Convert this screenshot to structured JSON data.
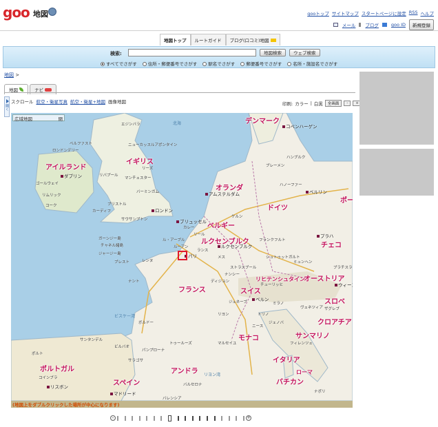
{
  "header": {
    "logo": "goo",
    "service": "地図",
    "links_top": [
      "gooトップ",
      "サイトマップ",
      "スタートページに設定",
      "RSS",
      "ヘルプ"
    ],
    "links_bottom": [
      "メール",
      "ブログ",
      "goo ID"
    ],
    "signup": "新規登録"
  },
  "tabs": [
    "地図トップ",
    "ルートガイド",
    "ブログ(口コミ)地図"
  ],
  "search": {
    "label": "検索:",
    "value": "",
    "map_button": "地図検索",
    "web_button": "ウェブ検索",
    "options": [
      "すべてでさがす",
      "住所・郵便番号でさがす",
      "駅名でさがす",
      "郵便番号でさがす",
      "名所・施設名でさがす"
    ],
    "selected": "すべてでさがす"
  },
  "breadcrumb": {
    "home": "地図",
    "sep": ">"
  },
  "map_tabs": [
    "地図",
    "ナビ"
  ],
  "modes": {
    "scroll": "スクロール",
    "aerial": "航空・衛星写真",
    "aerial_map": "航空・衛星+地図",
    "image_map": "画像地図"
  },
  "print": {
    "label": "印刷:",
    "color": "カラー",
    "sep": "|",
    "mono": "白黒",
    "fullscreen": "全画面",
    "minus": "-",
    "plus": "+"
  },
  "minimap": {
    "label": "広域地図",
    "close": "閉"
  },
  "side_handle": "開く",
  "map": {
    "countries": [
      {
        "name": "デンマーク"
      },
      {
        "name": "アイルランド"
      },
      {
        "name": "イギリス"
      },
      {
        "name": "オランダ"
      },
      {
        "name": "ドイツ"
      },
      {
        "name": "ベルギー"
      },
      {
        "name": "ルクセンブルク"
      },
      {
        "name": "チェコ"
      },
      {
        "name": "フランス"
      },
      {
        "name": "スイス"
      },
      {
        "name": "オーストリア"
      },
      {
        "name": "リヒテンシュタイン"
      },
      {
        "name": "スロベ"
      },
      {
        "name": "クロアチア"
      },
      {
        "name": "サンマリノ"
      },
      {
        "name": "モナコ"
      },
      {
        "name": "イタリア"
      },
      {
        "name": "ポルトガル"
      },
      {
        "name": "スペイン"
      },
      {
        "name": "アンドラ"
      },
      {
        "name": "ローマ"
      },
      {
        "name": "バチカン"
      },
      {
        "name": "ポー"
      }
    ],
    "cities": [
      "コペンハーゲン",
      "ダブリン",
      "ロンドン",
      "アムステルダム",
      "ベルリン",
      "ブリュッセル",
      "パリ",
      "プラハ",
      "ベルン",
      "マドリード",
      "リスボン",
      "ウィーン",
      "ルクセンブルク"
    ],
    "places": [
      "エジンバラ",
      "ニューカッスルアポンタイン",
      "リーズ",
      "マンチェスター",
      "リバプール",
      "バーミンガム",
      "ブリストル",
      "カーディフ",
      "サウサンプトン",
      "ハンブルク",
      "ブレーメン",
      "ハノーファー",
      "ケルン",
      "フランクフルト",
      "ミュンヘン",
      "シュトゥットガルト",
      "リヨン",
      "ボルドー",
      "ナント",
      "マルセイユ",
      "ニース",
      "トゥールーズ",
      "バルセロナ",
      "バレンシア",
      "ビルバオ",
      "ミラノ",
      "トリノ",
      "ジェノバ",
      "フィレンツェ",
      "ナポリ",
      "ヴェネツィア",
      "チャネル諸島",
      "ジャージー島",
      "ガーンジー島",
      "ビスケー湾",
      "北海",
      "リヨン湾",
      "ストラスブール",
      "チューリッヒ",
      "ジュネーブ",
      "ブラチスラバ",
      "ザグレブ",
      "ポルト",
      "コインブラ",
      "サンタンデル",
      "サラゴサ",
      "パンプローナ",
      "ディジョン",
      "レンヌ",
      "ランス",
      "メス",
      "ナンシー",
      "ル・アーブル",
      "ルーアン",
      "カレー",
      "リール",
      "ブレスト",
      "ロンドンデリー",
      "ベルファスト",
      "コーク",
      "リムリック",
      "ゴールウェイ"
    ]
  },
  "map_note": "(地図上をダブルクリックした場所が中心になります)",
  "zoom": {
    "minus": "-",
    "plus": "+",
    "level": 7,
    "levels": 18
  },
  "colors": {
    "brand": "#d8262b",
    "country_label": "#c3145c",
    "link": "#1d4ca3",
    "sea": "#a9cfe7",
    "land": "#f2efe6"
  }
}
